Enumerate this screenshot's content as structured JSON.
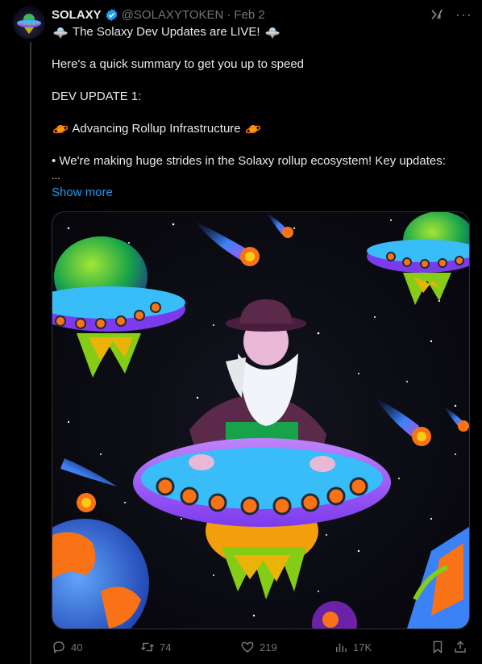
{
  "author": {
    "name": "SOLAXY",
    "handle": "@SOLAXYTOKEN",
    "separator": "·",
    "date": "Feb 2"
  },
  "post": {
    "line1": "The Solaxy Dev Updates are LIVE!",
    "line2": "Here's a quick summary to get you up to speed",
    "line3": "DEV UPDATE 1:",
    "line4": "Advancing Rollup Infrastructure",
    "line5": "• We're making huge strides in the Solaxy rollup ecosystem! Key updates:",
    "ellipsis": "...",
    "show_more": "Show more"
  },
  "icons": {
    "avatar": "ufo-avatar-icon",
    "verified": "verified-badge-icon",
    "grok": "grok-icon",
    "more": "more-options-icon",
    "ufo_emoji": "ufo-emoji-icon",
    "planet_emoji": "ringed-planet-emoji-icon"
  },
  "actions": {
    "replies": "40",
    "reposts": "74",
    "likes": "219",
    "views": "17K"
  },
  "colors": {
    "accent": "#1d9bf0",
    "verified": "#1d9bf0",
    "muted": "#71767b"
  }
}
